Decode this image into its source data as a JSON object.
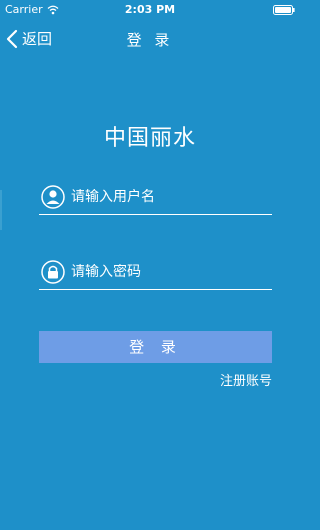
{
  "status_bar": {
    "carrier": "Carrier",
    "time": "2:03 PM"
  },
  "nav": {
    "back_label": "返回",
    "title": "登 录"
  },
  "app": {
    "title": "中国丽水"
  },
  "form": {
    "username_placeholder": "请输入用户名",
    "password_placeholder": "请输入密码",
    "login_label": "登 录",
    "register_label": "注册账号"
  },
  "colors": {
    "background": "#1e90c9",
    "button": "#6e9de6",
    "text": "#ffffff"
  },
  "icons": {
    "wifi": "wifi-icon",
    "battery": "battery-icon",
    "back": "chevron-left-icon",
    "user": "user-icon",
    "lock": "lock-icon"
  }
}
